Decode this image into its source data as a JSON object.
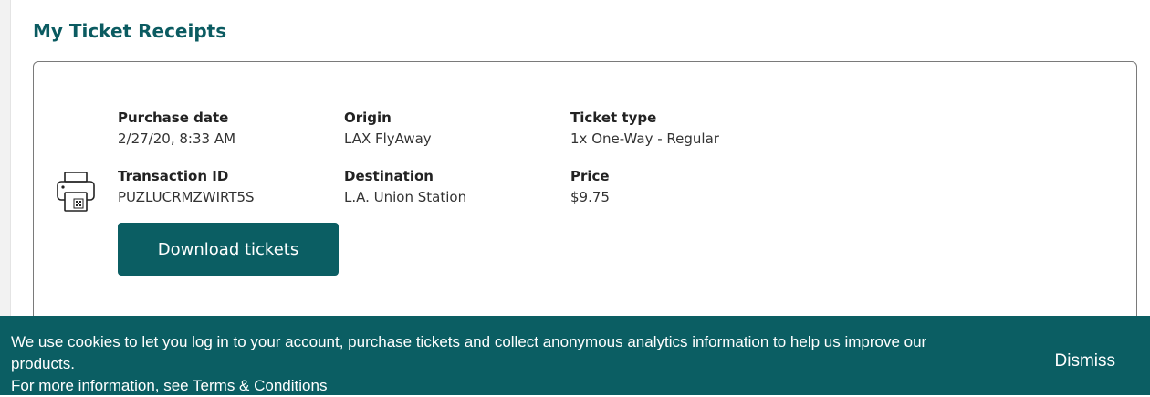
{
  "page": {
    "title": "My Ticket Receipts"
  },
  "receipt": {
    "icon": "printer-icon",
    "purchase_date_label": "Purchase date",
    "purchase_date": "2/27/20, 8:33 AM",
    "origin_label": "Origin",
    "origin": "LAX FlyAway",
    "ticket_type_label": "Ticket type",
    "ticket_type": "1x One-Way - Regular",
    "transaction_id_label": "Transaction ID",
    "transaction_id": "PUZLUCRMZWIRT5S",
    "destination_label": "Destination",
    "destination": "L.A. Union Station",
    "price_label": "Price",
    "price": "$9.75",
    "download_label": "Download tickets"
  },
  "cookie_banner": {
    "message": "We use cookies to let you log in to your account, purchase tickets and collect anonymous analytics information to help us improve our products.",
    "more_info_prefix": "For more information, see",
    "terms_link": " Terms & Conditions",
    "dismiss_label": "Dismiss"
  },
  "colors": {
    "brand": "#0b5e63",
    "title": "#0b5b61"
  }
}
